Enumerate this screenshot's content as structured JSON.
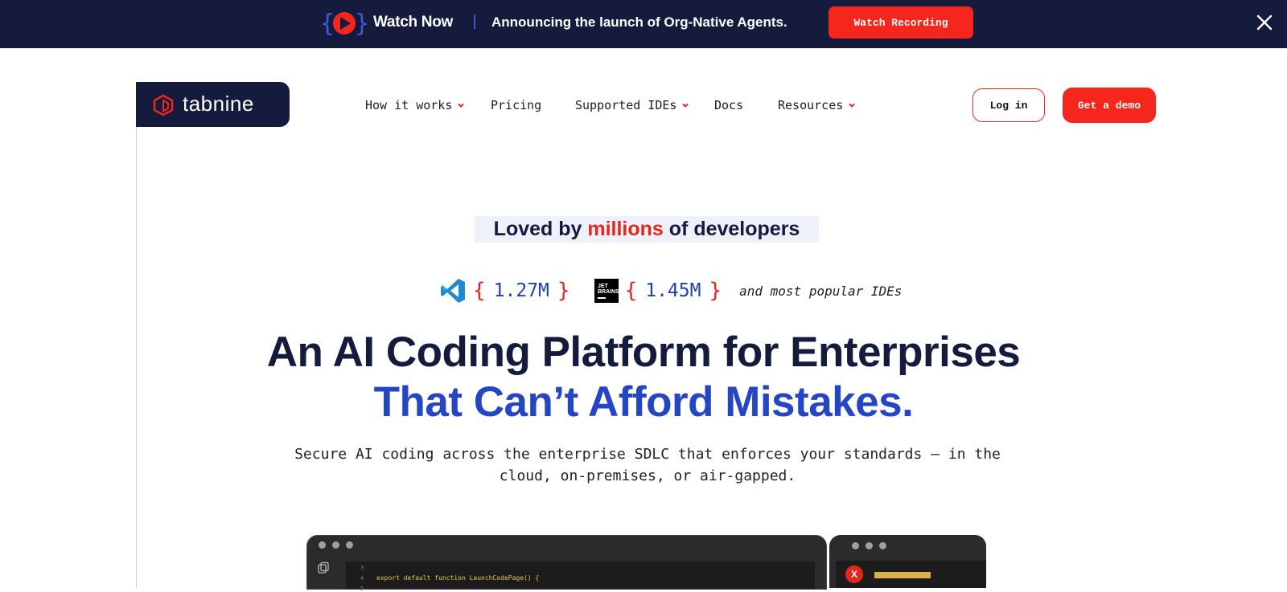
{
  "banner": {
    "watch_now": "Watch Now",
    "announcement": "Announcing the launch of Org-Native Agents.",
    "cta": "Watch Recording",
    "colors": {
      "bg": "#151b3d",
      "accent": "#f5261b"
    }
  },
  "brand": {
    "logo_text": "tabnine"
  },
  "nav": {
    "items": [
      {
        "label": "How it works",
        "dropdown": true
      },
      {
        "label": "Pricing",
        "dropdown": false
      },
      {
        "label": "Supported IDEs",
        "dropdown": true
      },
      {
        "label": "Docs",
        "dropdown": false
      },
      {
        "label": "Resources",
        "dropdown": true
      }
    ],
    "login": "Log in",
    "demo": "Get a demo"
  },
  "hero": {
    "loved_prefix": "Loved by ",
    "loved_highlight": "millions",
    "loved_suffix": " of developers",
    "stats": [
      {
        "ide": "vscode-icon",
        "value": "1.27M"
      },
      {
        "ide": "jetbrains-icon",
        "value": "1.45M"
      }
    ],
    "brace_open": "{",
    "brace_close": "}",
    "jetbrains_logo_text": "JET BRAINS",
    "ide_note": "and most popular IDEs",
    "headline_1": "An AI Coding Platform for Enterprises",
    "headline_2": "That Can’t Afford Mistakes.",
    "subtitle": "Secure AI coding across the enterprise SDLC that enforces your standards — in the cloud, on-premises, or air-gapped."
  },
  "preview": {
    "line_numbers": [
      "3",
      "4",
      "5"
    ],
    "code_line": "export default function LaunchCodePage() {",
    "side_badge": "X"
  }
}
